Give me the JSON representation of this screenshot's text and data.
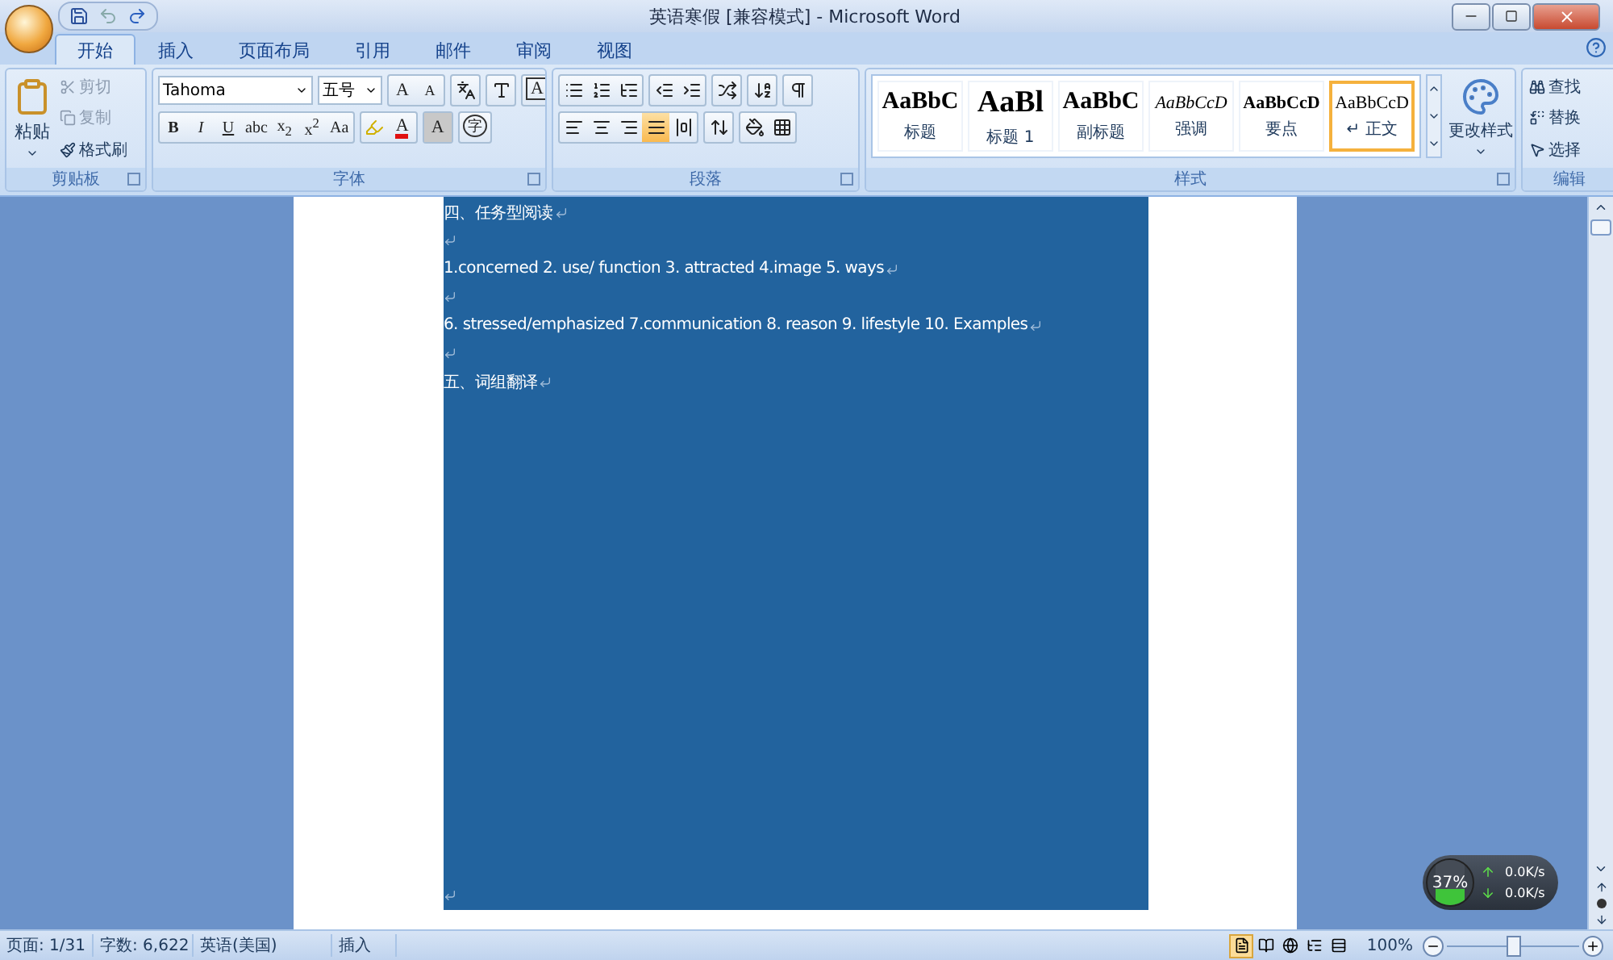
{
  "window": {
    "title": "英语寒假 [兼容模式] - Microsoft Word"
  },
  "tabs": [
    {
      "label": "开始",
      "selected": true
    },
    {
      "label": "插入",
      "selected": false
    },
    {
      "label": "页面布局",
      "selected": false
    },
    {
      "label": "引用",
      "selected": false
    },
    {
      "label": "邮件",
      "selected": false
    },
    {
      "label": "审阅",
      "selected": false
    },
    {
      "label": "视图",
      "selected": false
    }
  ],
  "clipboard": {
    "paste": "粘贴",
    "group": "剪贴板",
    "items": [
      {
        "kind": "cut",
        "label": "剪切",
        "disabled": true
      },
      {
        "kind": "copy",
        "label": "复制",
        "disabled": true
      },
      {
        "kind": "painter",
        "label": "格式刷",
        "disabled": false
      }
    ]
  },
  "font": {
    "name": "Tahoma",
    "size": "五号",
    "group": "字体",
    "grow": "A",
    "shrink": "A",
    "border": "A",
    "format_buttons": [
      "B",
      "I",
      "U",
      "abc",
      "x$_{2}$",
      "x$^{2}$",
      "Aa"
    ],
    "color_button": "A",
    "shading_button": "A",
    "enclose_button": "字"
  },
  "paragraph": {
    "group": "段落",
    "align": [
      {
        "kind": "left",
        "selected": false
      },
      {
        "kind": "center",
        "selected": false
      },
      {
        "kind": "right",
        "selected": false
      },
      {
        "kind": "justify",
        "selected": true
      },
      {
        "kind": "distributed",
        "selected": false
      }
    ]
  },
  "styles": {
    "group": "样式",
    "change": "更改样式",
    "items": [
      {
        "kind": "title",
        "preview": "AaBbC",
        "label": "标题",
        "selected": false
      },
      {
        "kind": "heading",
        "preview": "AaBl",
        "label": "标题 1",
        "selected": false
      },
      {
        "kind": "subtitle",
        "preview": "AaBbC",
        "label": "副标题",
        "selected": false
      },
      {
        "kind": "emphasis",
        "preview": "AaBbCcD",
        "label": "强调",
        "selected": false
      },
      {
        "kind": "strong",
        "preview": "AaBbCcD",
        "label": "要点",
        "selected": false
      },
      {
        "kind": "normal",
        "preview": "AaBbCcD",
        "label": "↵ 正文",
        "selected": true
      }
    ]
  },
  "editing": {
    "group": "编辑",
    "items": [
      {
        "kind": "find",
        "label": "查找"
      },
      {
        "kind": "replace",
        "label": "替换"
      },
      {
        "kind": "select",
        "label": "选择"
      }
    ]
  },
  "document": {
    "lines": [
      {
        "kind": "text",
        "text": "四、任务型阅读"
      },
      {
        "kind": "blank"
      },
      {
        "kind": "text",
        "text": "1.concerned 2. use/ function 3. attracted 4.image 5. ways"
      },
      {
        "kind": "blank"
      },
      {
        "kind": "text",
        "text": "6. stressed/emphasized  7.communication 8. reason 9. lifestyle 10. Examples"
      },
      {
        "kind": "blank"
      },
      {
        "kind": "text",
        "text": "五、词组翻译"
      }
    ]
  },
  "net_meter": {
    "percent": "37%",
    "level": 0.37,
    "up": "0.0K/s",
    "down": "0.0K/s"
  },
  "status_bar": {
    "items": [
      "页面: 1/31",
      "字数: 6,622",
      "英语(美国)",
      "插入"
    ],
    "views": [
      {
        "kind": "print",
        "selected": true
      },
      {
        "kind": "reading",
        "selected": false
      },
      {
        "kind": "web",
        "selected": false
      },
      {
        "kind": "outline",
        "selected": false
      },
      {
        "kind": "draft",
        "selected": false
      }
    ],
    "zoom": "100%",
    "zoom_slider": {
      "level": 0.5
    }
  }
}
